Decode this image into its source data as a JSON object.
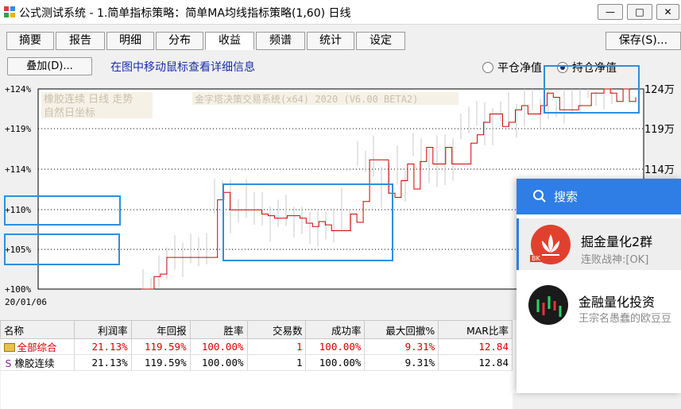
{
  "window": {
    "title": "公式测试系统 - 1.简单指标策略：简单MA均线指标策略(1,60) 日线",
    "min_glyph": "—",
    "max_glyph": "□",
    "close_glyph": "✕"
  },
  "tabs": [
    "摘要",
    "报告",
    "明细",
    "分布",
    "收益",
    "频谱",
    "统计",
    "设定"
  ],
  "active_tab": "收益",
  "save_button": "保存(S)...",
  "overlay_button": "叠加(D)...",
  "hint_text": "在图中移动鼠标查看详细信息",
  "radios": [
    {
      "label": "平仓净值",
      "selected": false
    },
    {
      "label": "持仓净值",
      "selected": true
    }
  ],
  "chart_info": {
    "legend_line1": "橡胶连续 日线 走势",
    "legend_line2": "自然日坐标",
    "watermark": "金字塔决策交易系统(x64) 2020 (V6.00 BETA2)",
    "left_ticks": [
      "+124%",
      "+119%",
      "+114%",
      "+110%",
      "+105%",
      "+100%"
    ],
    "right_ticks": [
      "124万",
      "119万",
      "114万"
    ],
    "x_label": "20/01/06"
  },
  "chart_data": {
    "type": "line",
    "ylim": [
      100,
      124
    ],
    "equity_series": [
      100,
      100,
      101.5,
      101.8,
      103.8,
      103.8,
      103.8,
      103.8,
      103.8,
      103.8,
      103.8,
      103.8,
      110.7,
      111.6,
      109.5,
      109.5,
      109.5,
      109.5,
      109.5,
      109,
      108.8,
      108.5,
      108.5,
      108.8,
      108.8,
      108.5,
      107.9,
      107.5,
      108.1,
      107.7,
      107.0,
      107.0,
      107.0,
      109.0,
      108.0,
      110.5,
      115.5,
      115.5,
      115.5,
      111.5,
      111.0,
      113.0,
      115.0,
      112.0,
      115.3,
      117.0,
      115.0,
      115.0,
      117.0,
      115.0,
      115.0,
      115.0,
      117.5,
      118.5,
      120.0,
      121.0,
      121.0,
      119.5,
      120.0,
      121.5,
      122.0,
      121.0,
      121.0,
      122.0,
      123.5,
      123.0,
      121.5,
      121.5,
      121.5,
      122.0,
      122.0,
      123.5,
      123.5,
      124.0,
      123.5,
      122.5,
      124.0,
      122.5,
      123.0
    ]
  },
  "table": {
    "headers": [
      "名称",
      "利润率",
      "年回报",
      "胜率",
      "交易数",
      "成功率",
      "最大回撤%",
      "MAR比率"
    ],
    "rows": [
      {
        "name": "全部综合",
        "icon": "folder-icon",
        "values": [
          "21.13%",
          "119.59%",
          "100.00%",
          "1",
          "100.00%",
          "9.31%",
          "12.84"
        ]
      },
      {
        "name": "橡胶连续",
        "icon": "S",
        "values": [
          "21.13%",
          "119.59%",
          "100.00%",
          "1",
          "100.00%",
          "9.31%",
          "12.84"
        ]
      }
    ]
  },
  "chat_popup": {
    "search_placeholder": "搜索",
    "items": [
      {
        "name": "掘金量化2群",
        "message": "连败战神:[OK]",
        "badge": "BK"
      },
      {
        "name": "金融量化投资",
        "message": "王宗名愚蠢的欧豆豆"
      }
    ]
  },
  "colors": {
    "accent": "#2e7ee6",
    "equity_line": "#d40000",
    "highlight": "#2f8fdc"
  }
}
